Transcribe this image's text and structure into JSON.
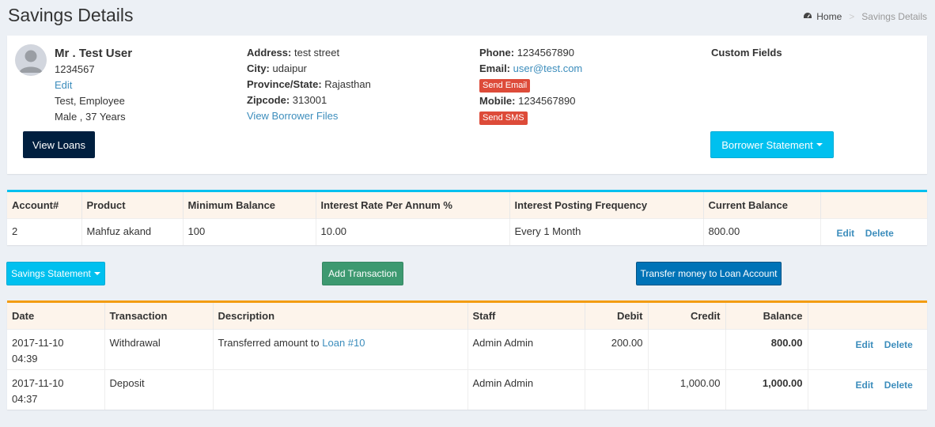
{
  "page": {
    "title": "Savings Details"
  },
  "breadcrumb": {
    "home": "Home",
    "separator": ">",
    "current": "Savings Details"
  },
  "borrower": {
    "name": "Mr . Test User",
    "id": "1234567",
    "edit": "Edit",
    "type": "Test, Employee",
    "gender_age": "Male , 37 Years",
    "address_label": "Address:",
    "address": "test street",
    "city_label": "City:",
    "city": "udaipur",
    "province_label": "Province/State:",
    "province": "Rajasthan",
    "zip_label": "Zipcode:",
    "zip": "313001",
    "files_link": "View Borrower Files",
    "phone_label": "Phone:",
    "phone": "1234567890",
    "email_label": "Email:",
    "email": "user@test.com",
    "send_email": "Send Email",
    "mobile_label": "Mobile:",
    "mobile": "1234567890",
    "send_sms": "Send SMS",
    "custom_fields": "Custom Fields"
  },
  "buttons": {
    "view_loans": "View Loans",
    "borrower_statement": "Borrower Statement",
    "savings_statement": "Savings Statement",
    "add_transaction": "Add Transaction",
    "transfer": "Transfer money to Loan Account"
  },
  "account_table": {
    "headers": [
      "Account#",
      "Product",
      "Minimum Balance",
      "Interest Rate Per Annum %",
      "Interest Posting Frequency",
      "Current Balance"
    ],
    "row": {
      "account": "2",
      "product": "Mahfuz akand",
      "min_balance": "100",
      "rate": "10.00",
      "frequency": "Every 1 Month",
      "balance": "800.00",
      "edit": "Edit",
      "delete": "Delete"
    }
  },
  "transactions": {
    "headers": {
      "date": "Date",
      "transaction": "Transaction",
      "description": "Description",
      "staff": "Staff",
      "debit": "Debit",
      "credit": "Credit",
      "balance": "Balance"
    },
    "rows": [
      {
        "date": "2017-11-10",
        "time": "04:39",
        "type": "Withdrawal",
        "desc_text": "Transferred amount to ",
        "desc_link": "Loan #10",
        "staff": "Admin Admin",
        "debit": "200.00",
        "credit": "",
        "balance": "800.00",
        "edit": "Edit",
        "delete": "Delete"
      },
      {
        "date": "2017-11-10",
        "time": "04:37",
        "type": "Deposit",
        "desc_text": "",
        "desc_link": "",
        "staff": "Admin Admin",
        "debit": "",
        "credit": "1,000.00",
        "balance": "1,000.00",
        "edit": "Edit",
        "delete": "Delete"
      }
    ]
  },
  "colors": {
    "info": "#00c0ef",
    "warning": "#f39c12",
    "danger": "#dd4b39",
    "link": "#3c8dbc",
    "navy": "#001f3f",
    "olive": "#3d9970",
    "primary": "#0073b7"
  }
}
